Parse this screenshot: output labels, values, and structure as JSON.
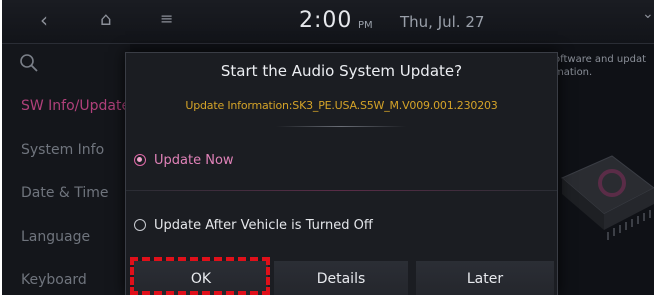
{
  "status_bar": {
    "time": "2:00",
    "ampm": "PM",
    "date": "Thu, Jul. 27"
  },
  "sidebar": {
    "items": [
      {
        "label": "SW Info/Update",
        "active": true
      },
      {
        "label": "System Info",
        "active": false
      },
      {
        "label": "Date & Time",
        "active": false
      },
      {
        "label": "Language",
        "active": false
      },
      {
        "label": "Keyboard",
        "active": false
      }
    ]
  },
  "background": {
    "text_line1": "oftware and updat",
    "text_line2": "mation."
  },
  "dialog": {
    "title": "Start the Audio System Update?",
    "info": "Update Information:SK3_PE.USA.S5W_M.V009.001.230203",
    "options": [
      {
        "label": "Update Now",
        "selected": true
      },
      {
        "label": "Update After Vehicle is Turned Off",
        "selected": false
      }
    ],
    "buttons": {
      "ok": "OK",
      "details": "Details",
      "later": "Later"
    }
  },
  "colors": {
    "accent": "#e082b8",
    "info_text": "#d4a328",
    "highlight": "#e0101a"
  },
  "icons": {
    "back": "back-icon",
    "home": "home-icon",
    "menu": "menu-icon",
    "search": "search-icon"
  }
}
